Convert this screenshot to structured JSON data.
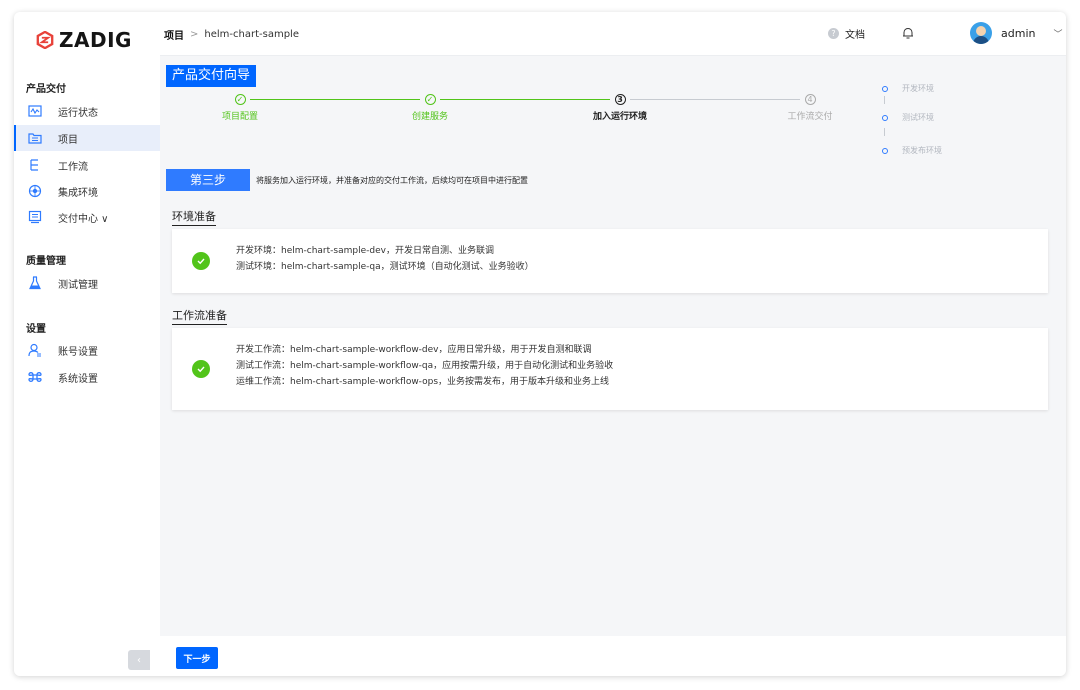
{
  "brand": {
    "name": "ZADIG",
    "color": "#e8423a",
    "icon": "zadig-logo-icon"
  },
  "accent_color": "#0066ff",
  "success_color": "#52c41a",
  "sidebar": {
    "groups": [
      {
        "title": "产品交付",
        "items": [
          {
            "label": "运行状态",
            "icon": "monitor-icon"
          },
          {
            "label": "项目",
            "icon": "project-icon",
            "active": true
          },
          {
            "label": "工作流",
            "icon": "workflow-icon"
          },
          {
            "label": "集成环境",
            "icon": "environment-icon"
          },
          {
            "label": "交付中心 ∨",
            "icon": "delivery-icon"
          }
        ]
      },
      {
        "title": "质量管理",
        "items": [
          {
            "label": "测试管理",
            "icon": "flask-icon"
          }
        ]
      },
      {
        "title": "设置",
        "items": [
          {
            "label": "账号设置",
            "icon": "user-settings-icon"
          },
          {
            "label": "系统设置",
            "icon": "system-settings-icon"
          }
        ]
      }
    ],
    "collapse_glyph": "‹"
  },
  "header": {
    "breadcrumb_root": "项目",
    "breadcrumb_sep": ">",
    "breadcrumb_current": "helm-chart-sample",
    "docs_label": "文档",
    "user_name": "admin",
    "chevron": "﹀"
  },
  "wizard": {
    "title": "产品交付向导",
    "steps": [
      {
        "label": "项目配置",
        "state": "done",
        "marker": "✓"
      },
      {
        "label": "创建服务",
        "state": "done",
        "marker": "✓"
      },
      {
        "label": "加入运行环境",
        "state": "current",
        "marker": "3"
      },
      {
        "label": "工作流交付",
        "state": "todo",
        "marker": "4"
      }
    ],
    "env_steps": [
      "开发环境",
      "测试环境",
      "预发布环境"
    ]
  },
  "step3": {
    "badge": "第三步",
    "description": "将服务加入运行环境，并准备对应的交付工作流，后续均可在项目中进行配置"
  },
  "env_section": {
    "title": "环境准备",
    "lines": [
      "开发环境：helm-chart-sample-dev，开发日常自测、业务联调",
      "测试环境：helm-chart-sample-qa，测试环境（自动化测试、业务验收）"
    ]
  },
  "workflow_section": {
    "title": "工作流准备",
    "lines": [
      "开发工作流：helm-chart-sample-workflow-dev，应用日常升级，用于开发自测和联调",
      "测试工作流：helm-chart-sample-workflow-qa，应用按需升级，用于自动化测试和业务验收",
      "运维工作流：helm-chart-sample-workflow-ops，业务按需发布，用于版本升级和业务上线"
    ]
  },
  "footer": {
    "next_label": "下一步"
  }
}
